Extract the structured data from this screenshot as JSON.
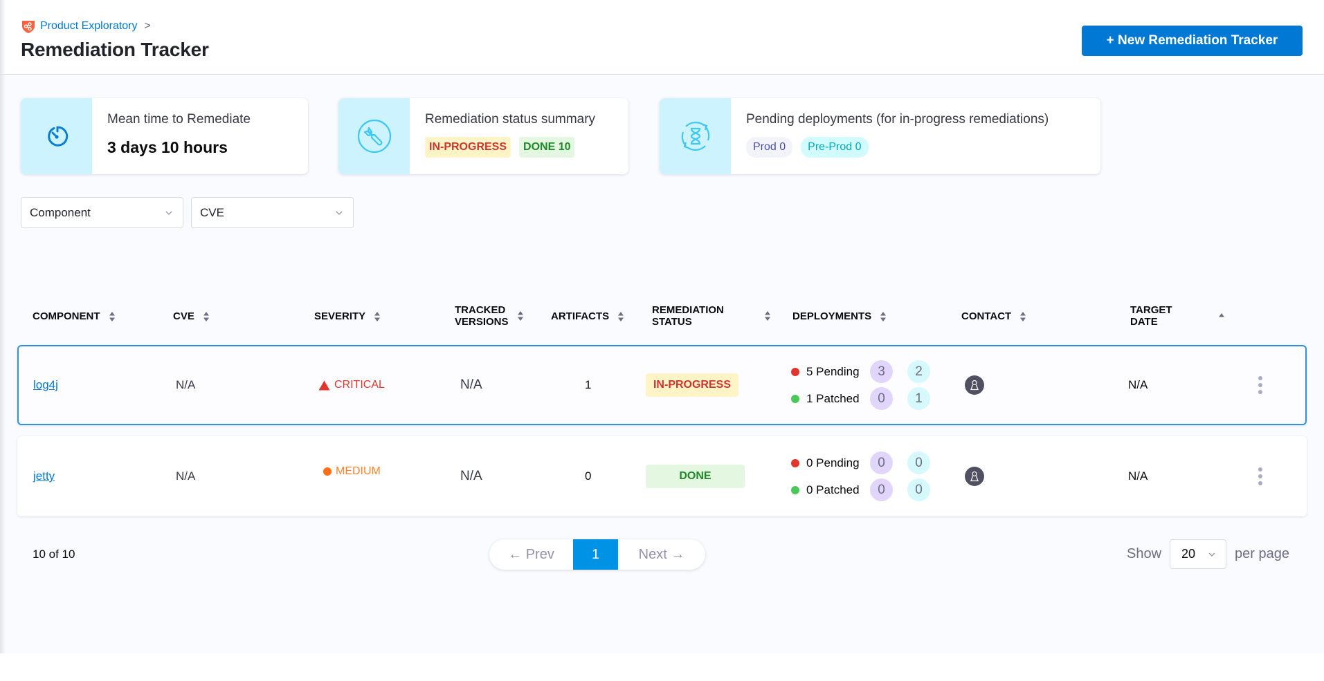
{
  "header": {
    "breadcrumb": {
      "label": "Product Exploratory",
      "separator": ">",
      "logo_icon": "harness-sto-shield-icon"
    },
    "title": "Remediation Tracker",
    "new_button_label": "+ New Remediation Tracker"
  },
  "summary_cards": {
    "mttr": {
      "icon": "timer-icon",
      "title": "Mean time to Remediate",
      "value": "3 days 10 hours"
    },
    "status_summary": {
      "icon": "wrench-icon",
      "title": "Remediation status summary",
      "badges": [
        {
          "label": "IN-PROGRESS"
        },
        {
          "label": "DONE 10"
        }
      ]
    },
    "pending_deployments": {
      "icon": "hourglass-refresh-icon",
      "title": "Pending deployments (for in-progress remediations)",
      "pills": [
        {
          "label": "Prod 0"
        },
        {
          "label": "Pre-Prod 0"
        }
      ]
    }
  },
  "filters": [
    {
      "label": "Component"
    },
    {
      "label": "CVE"
    }
  ],
  "table": {
    "columns": [
      {
        "label": "COMPONENT",
        "sort": "none"
      },
      {
        "label": "CVE",
        "sort": "none"
      },
      {
        "label": "SEVERITY",
        "sort": "none"
      },
      {
        "label": "TRACKED\nVERSIONS",
        "sort": "none"
      },
      {
        "label": "ARTIFACTS",
        "sort": "none"
      },
      {
        "label": "REMEDIATION\nSTATUS",
        "sort": "none"
      },
      {
        "label": "DEPLOYMENTS",
        "sort": "none"
      },
      {
        "label": "CONTACT",
        "sort": "none"
      },
      {
        "label": "TARGET\nDATE",
        "sort": "ascending"
      }
    ],
    "rows": [
      {
        "component": "log4j",
        "cve": "N/A",
        "severity": "CRITICAL",
        "tracked_versions": "N/A",
        "artifacts": "1",
        "status": "IN-PROGRESS",
        "deployments": {
          "pending_label": "5 Pending",
          "pending_prod": "3",
          "pending_preprod": "2",
          "patched_label": "1 Patched",
          "patched_prod": "0",
          "patched_preprod": "1"
        },
        "contact_icon": "user-avatar-icon",
        "target_date": "N/A",
        "selected": true
      },
      {
        "component": "jetty",
        "cve": "N/A",
        "severity": "MEDIUM",
        "tracked_versions": "N/A",
        "artifacts": "0",
        "status": "DONE",
        "deployments": {
          "pending_label": "0 Pending",
          "pending_prod": "0",
          "pending_preprod": "0",
          "patched_label": "0 Patched",
          "patched_prod": "0",
          "patched_preprod": "0"
        },
        "contact_icon": "user-avatar-icon",
        "target_date": "N/A",
        "selected": false
      }
    ]
  },
  "pagination": {
    "count_label": "10 of 10",
    "prev_label": "← Prev",
    "current_page": "1",
    "next_label": "Next →",
    "show_label": "Show",
    "per_page_value": "20",
    "per_page_suffix": "per page"
  },
  "colors": {
    "primary": "#0278d5",
    "critical": "#e0362d",
    "medium": "#ff832b",
    "in_progress_bg": "#fff3c8",
    "done_bg": "#e4f7e1",
    "card_icon_bg": "#cdf4fe"
  }
}
